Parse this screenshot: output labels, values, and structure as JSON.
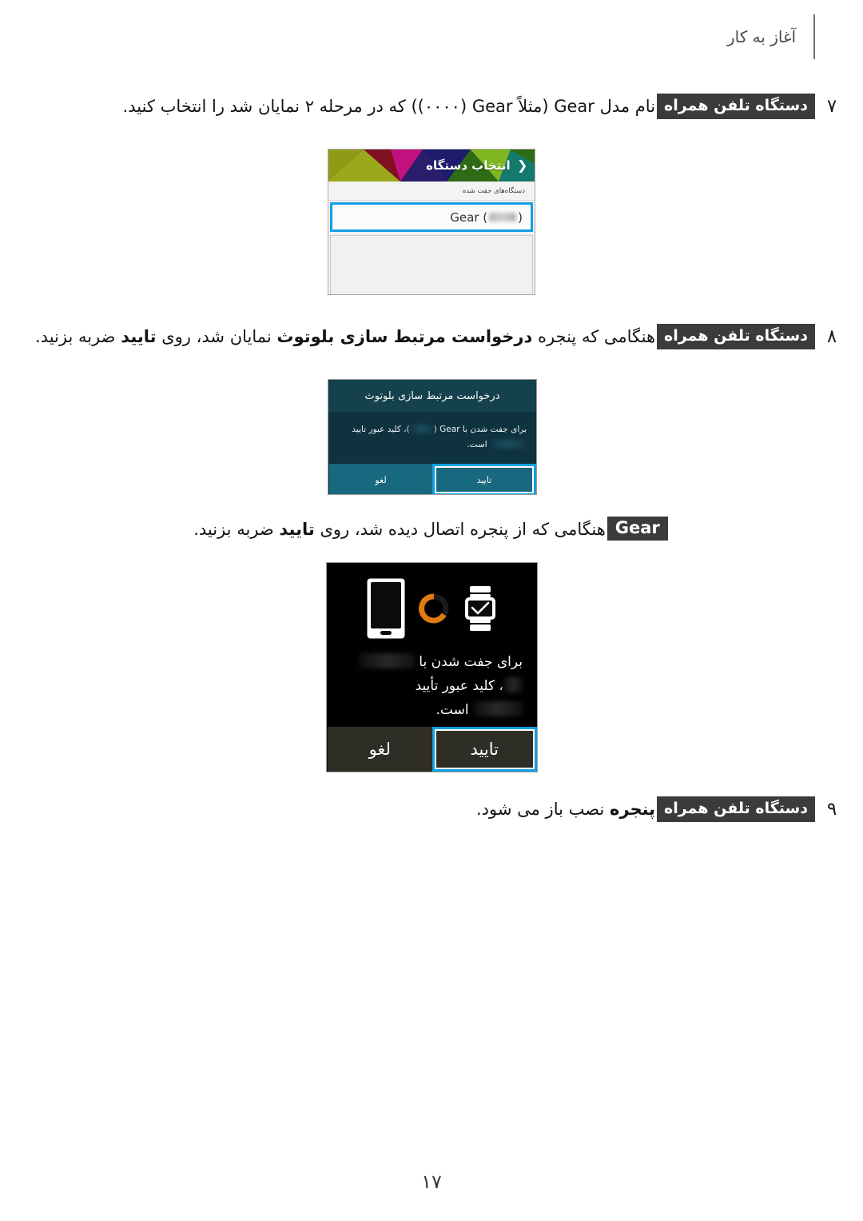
{
  "header": {
    "title": "آغاز به کار",
    "divider_icon": "vertical-rule-icon"
  },
  "page_number": "۱۷",
  "steps": [
    {
      "number": "۷",
      "badge": "دستگاه تلفن همراه",
      "text_a": "نام مدل ",
      "latin_a": "Gear",
      "text_b": " (مثلاً ",
      "latin_b": "Gear",
      "text_c": " (۰۰۰۰)) که در مرحله ۲ نمایان شد را انتخاب کنید."
    },
    {
      "number": "۸",
      "badge": "دستگاه تلفن همراه",
      "text_a": "هنگامی که پنجره ",
      "bold_a": "درخواست مرتبط سازی بلوتوث",
      "text_b": " نمایان شد، روی ",
      "bold_b": "تایید",
      "text_c": " ضربه بزنید."
    },
    {
      "number": "",
      "badge": "Gear",
      "text_a": "هنگامی که از پنجره اتصال دیده شد، روی ",
      "bold_a": "تایید",
      "text_b": " ضربه بزنید."
    },
    {
      "number": "۹",
      "badge": "دستگاه تلفن همراه",
      "bold_a": "پنجره",
      "text_a": " نصب باز می شود."
    }
  ],
  "screenshot_device_picker": {
    "appbar_title": "انتخاب دستگاه",
    "back_icon": "chevron-back-icon",
    "section_label": "دستگاه‌های جفت شده",
    "row_label": "Gear (",
    "row_label_end": ")",
    "row_redacted": "redacted-device-id",
    "banner_colors": [
      "#7f1020",
      "#8d9b17",
      "#c2117f",
      "#1d1b6e",
      "#2d6b16",
      "#7fb723",
      "#157a6e"
    ],
    "highlight_color": "#119fe3"
  },
  "screenshot_bluetooth_dialog": {
    "title": "درخواست مرتبط سازی بلوتوث",
    "body_a": "برای جفت شدن با ",
    "body_latin": "Gear",
    "body_b": " (",
    "body_c": ")، کلید عبور تایید ",
    "body_d": " است.",
    "cancel_label": "لغو",
    "confirm_label": "تایید",
    "redacted_device": "redacted-device-id",
    "redacted_passkey": "redacted-passkey",
    "bg_color": "#0e333f",
    "button_color": "#18687f",
    "highlight_color": "#119fe3"
  },
  "screenshot_gear_watch": {
    "watch_icon": "watch-check-icon",
    "spinner_icon": "loading-ring-icon",
    "phone_icon": "phone-icon",
    "body_a": "برای جفت شدن با ",
    "body_b": "، کلید عبور تأیید ",
    "body_c": " است.",
    "redacted_device": "redacted-device-id",
    "redacted_passkey": "redacted-passkey",
    "cancel_label": "لغو",
    "confirm_label": "تایید",
    "spinner_color": "#e07a10",
    "bg_color": "#000000",
    "button_color": "#2e2e26",
    "highlight_color": "#119fe3"
  }
}
